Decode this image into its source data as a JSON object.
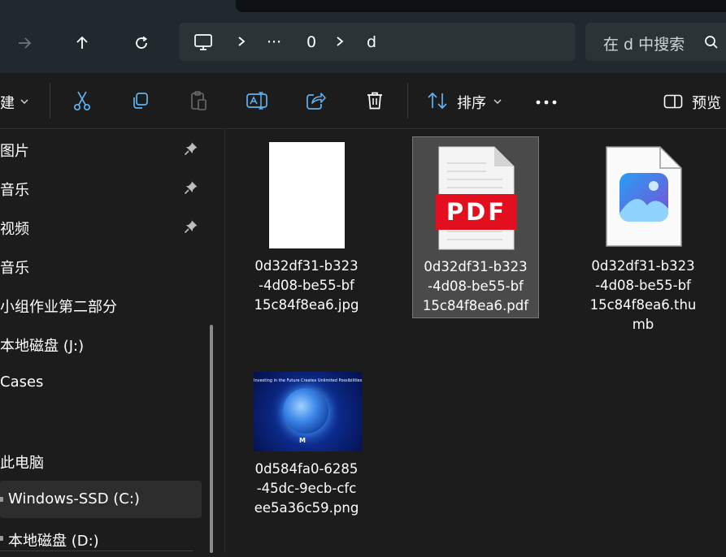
{
  "address_bar": {
    "ellipsis": "···",
    "segment_1": "0",
    "segment_2": "d"
  },
  "search": {
    "placeholder": "在 d 中搜索"
  },
  "toolbar": {
    "new_label": "建",
    "sort_label": "排序",
    "more_label": "···",
    "preview_label": "预览"
  },
  "sidebar": {
    "items": [
      {
        "label": "图片",
        "pinned": true
      },
      {
        "label": "音乐",
        "pinned": true
      },
      {
        "label": "视频",
        "pinned": true
      },
      {
        "label": "音乐",
        "pinned": false
      },
      {
        "label": "小组作业第二部分",
        "pinned": false
      },
      {
        "label": "本地磁盘 (J:)",
        "pinned": false
      },
      {
        "label": "Cases",
        "pinned": false
      },
      {
        "label": "此电脑",
        "pinned": false
      },
      {
        "label": "Windows-SSD (C:)",
        "pinned": false,
        "selected": true
      },
      {
        "label": "本地磁盘 (D:)",
        "pinned": false
      }
    ]
  },
  "files": [
    {
      "name_lines": [
        "0d32df31-b323",
        "-4d08-be55-bf",
        "15c84f8ea6.jpg"
      ],
      "icon": "white-image-thumbnail"
    },
    {
      "name_lines": [
        "0d32df31-b323",
        "-4d08-be55-bf",
        "15c84f8ea6.pdf"
      ],
      "icon": "pdf-file-icon",
      "selected": true,
      "pdf_badge": "PDF"
    },
    {
      "name_lines": [
        "0d32df31-b323",
        "-4d08-be55-bf",
        "15c84f8ea6.thu",
        "mb"
      ],
      "icon": "photos-file-icon"
    },
    {
      "name_lines": [
        "0d584fa0-6285",
        "-45dc-9ecb-cfc",
        "ee5a36c59.png"
      ],
      "icon": "earth-image-thumbnail",
      "thumb_caption": "Investing in the Future Creates Unlimited Possibilities",
      "thumb_logo": "M"
    }
  ],
  "colors": {
    "accent": "#5fb2f2",
    "pdf_red": "#e30f1f",
    "selection": "#4a4a4a"
  }
}
